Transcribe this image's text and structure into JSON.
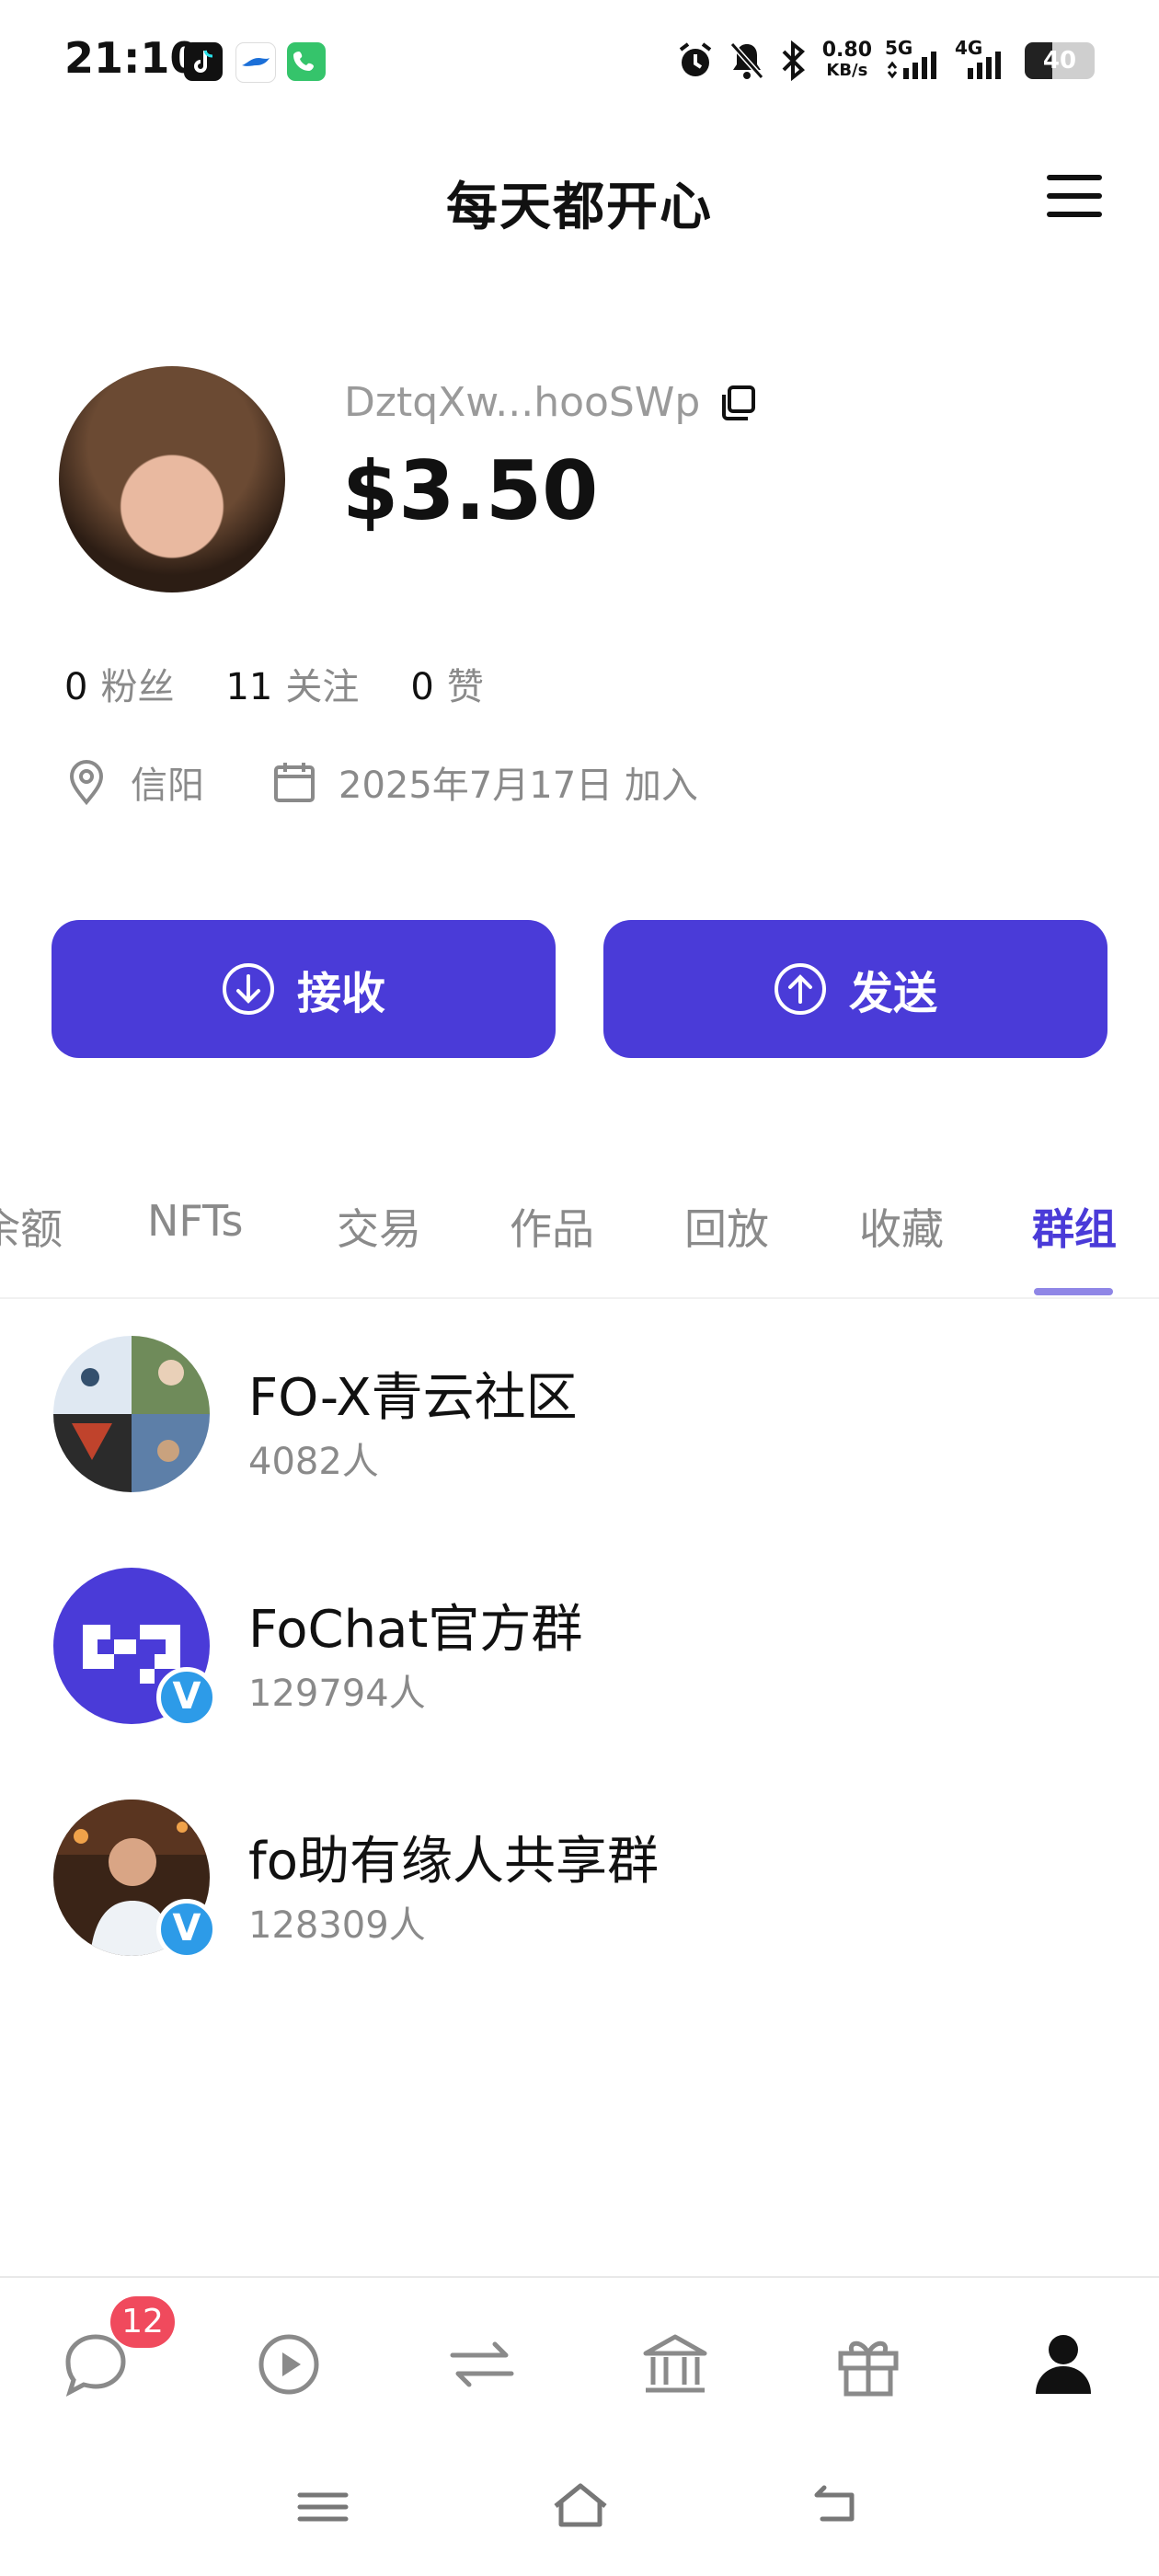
{
  "status_bar": {
    "time": "21:10",
    "speed_value": "0.80",
    "speed_unit": "KB/s",
    "net_5g": "5G",
    "net_4g": "4G",
    "battery_text": "40",
    "battery_level": 0.4
  },
  "header": {
    "title": "每天都开心"
  },
  "profile": {
    "address": "DztqXw...hooSWp",
    "balance": "$3.50",
    "stats": [
      {
        "value": "0",
        "label": "粉丝"
      },
      {
        "value": "11",
        "label": "关注"
      },
      {
        "value": "0",
        "label": "赞"
      }
    ],
    "location": "信阳",
    "joined": "2025年7月17日 加入"
  },
  "actions": {
    "receive_label": "接收",
    "send_label": "发送"
  },
  "tabs": [
    {
      "label": "余额"
    },
    {
      "label": "NFTs"
    },
    {
      "label": "交易"
    },
    {
      "label": "作品"
    },
    {
      "label": "回放"
    },
    {
      "label": "收藏"
    },
    {
      "label": "群组"
    }
  ],
  "active_tab": "群组",
  "groups": [
    {
      "name": "FO-X青云社区",
      "count": "4082人"
    },
    {
      "name": "FoChat官方群",
      "count": "129794人",
      "verified_mark": "V"
    },
    {
      "name": "fo助有缘人共享群",
      "count": "128309人",
      "verified_mark": "V"
    }
  ],
  "bottom_nav": {
    "chat_badge": "12"
  },
  "colors": {
    "accent": "#4a3bd8",
    "badge_red": "#f04a5d",
    "verified_blue": "#2d9be8",
    "muted_text": "#8a8a8a"
  }
}
